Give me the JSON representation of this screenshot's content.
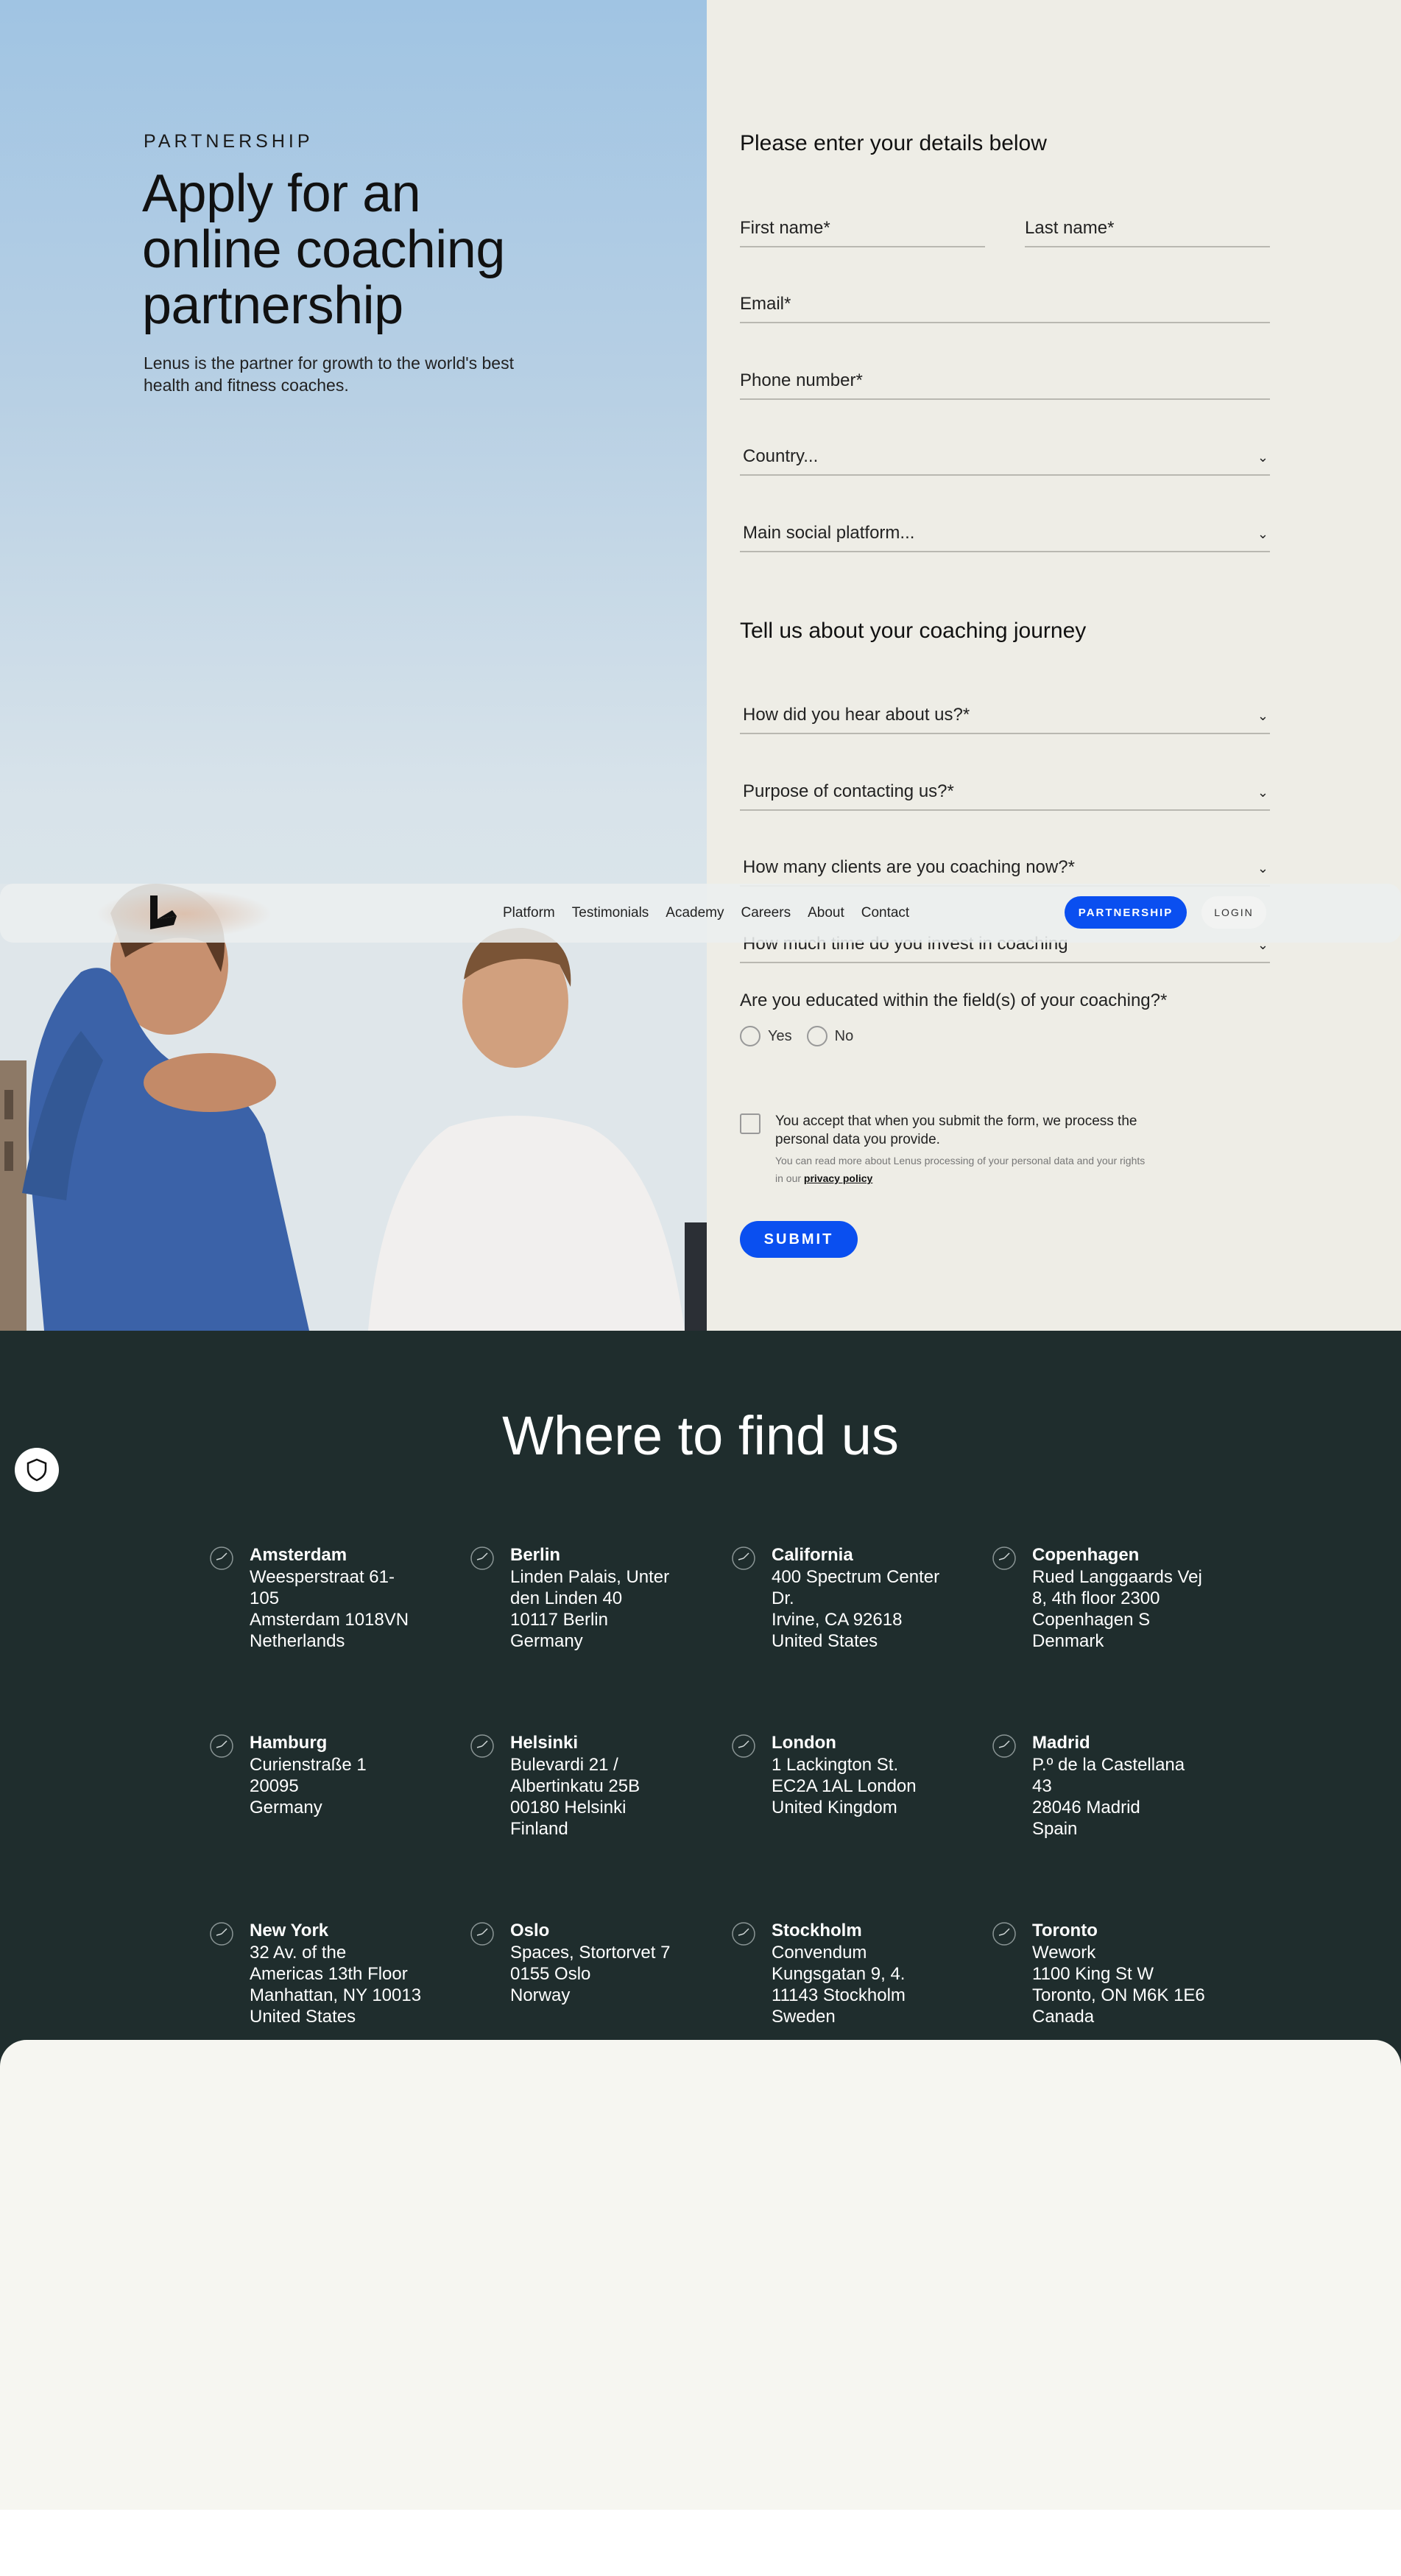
{
  "hero": {
    "eyebrow": "PARTNERSHIP",
    "title": "Apply for an online coaching partnership",
    "description": "Lenus is the partner for growth to the world's best health and fitness coaches."
  },
  "form": {
    "heading": "Please enter your details below",
    "first_name": "First name*",
    "last_name": "Last name*",
    "email": "Email*",
    "phone": "Phone number*",
    "country": "Country...",
    "social": "Main social platform...",
    "journey_heading": "Tell us about your coaching journey",
    "hear_about": "How did you hear about us?*",
    "purpose": "Purpose of contacting us?*",
    "clients": "How many clients are you coaching now?*",
    "time": "How much time do you invest in coaching",
    "educated_q": "Are you educated within the field(s) of your coaching?*",
    "yes": "Yes",
    "no": "No",
    "consent_main": "You accept that when you submit the form, we process the personal data you provide.",
    "consent_small": "You can read more about Lenus processing of your personal data and your rights in our",
    "privacy_link": "privacy policy",
    "submit": "SUBMIT"
  },
  "nav": {
    "links": [
      "Platform",
      "Testimonials",
      "Academy",
      "Careers",
      "About",
      "Contact"
    ],
    "partnership": "PARTNERSHIP",
    "login": "LOGIN"
  },
  "offices": {
    "title": "Where to find us",
    "list": [
      {
        "name": "Amsterdam",
        "address": "Weesperstraat 61-\n105\nAmsterdam 1018VN\nNetherlands"
      },
      {
        "name": "Berlin",
        "address": "Linden Palais, Unter\nden Linden 40\n10117 Berlin\nGermany"
      },
      {
        "name": "California",
        "address": "400 Spectrum Center\nDr.\nIrvine, CA 92618\nUnited States"
      },
      {
        "name": "Copenhagen",
        "address": "Rued Langgaards Vej\n8, 4th floor 2300\nCopenhagen S\nDenmark"
      },
      {
        "name": "Hamburg",
        "address": "Curienstraße 1\n20095\nGermany"
      },
      {
        "name": "Helsinki",
        "address": "Bulevardi 21 /\nAlbertinkatu 25B\n00180 Helsinki\nFinland"
      },
      {
        "name": "London",
        "address": "1 Lackington St.\nEC2A 1AL London\nUnited Kingdom"
      },
      {
        "name": "Madrid",
        "address": "P.º de la Castellana\n43\n28046 Madrid\nSpain"
      },
      {
        "name": "New York",
        "address": "32 Av. of the\nAmericas 13th Floor\nManhattan, NY 10013\nUnited States"
      },
      {
        "name": "Oslo",
        "address": "Spaces, Stortorvet 7\n0155 Oslo\nNorway"
      },
      {
        "name": "Stockholm",
        "address": "Convendum\nKungsgatan 9, 4.\n11143 Stockholm\nSweden"
      },
      {
        "name": "Toronto",
        "address": "Wework\n1100 King St W\nToronto, ON M6K 1E6\nCanada"
      }
    ]
  },
  "colors": {
    "accent": "#0a4ff0",
    "dark": "#1f2d2d",
    "form_bg": "#eeede6"
  },
  "icons": {
    "logo": "lenus-logo-icon",
    "clock": "clock-icon",
    "shield": "shield-icon",
    "chevron": "chevron-down-icon"
  }
}
